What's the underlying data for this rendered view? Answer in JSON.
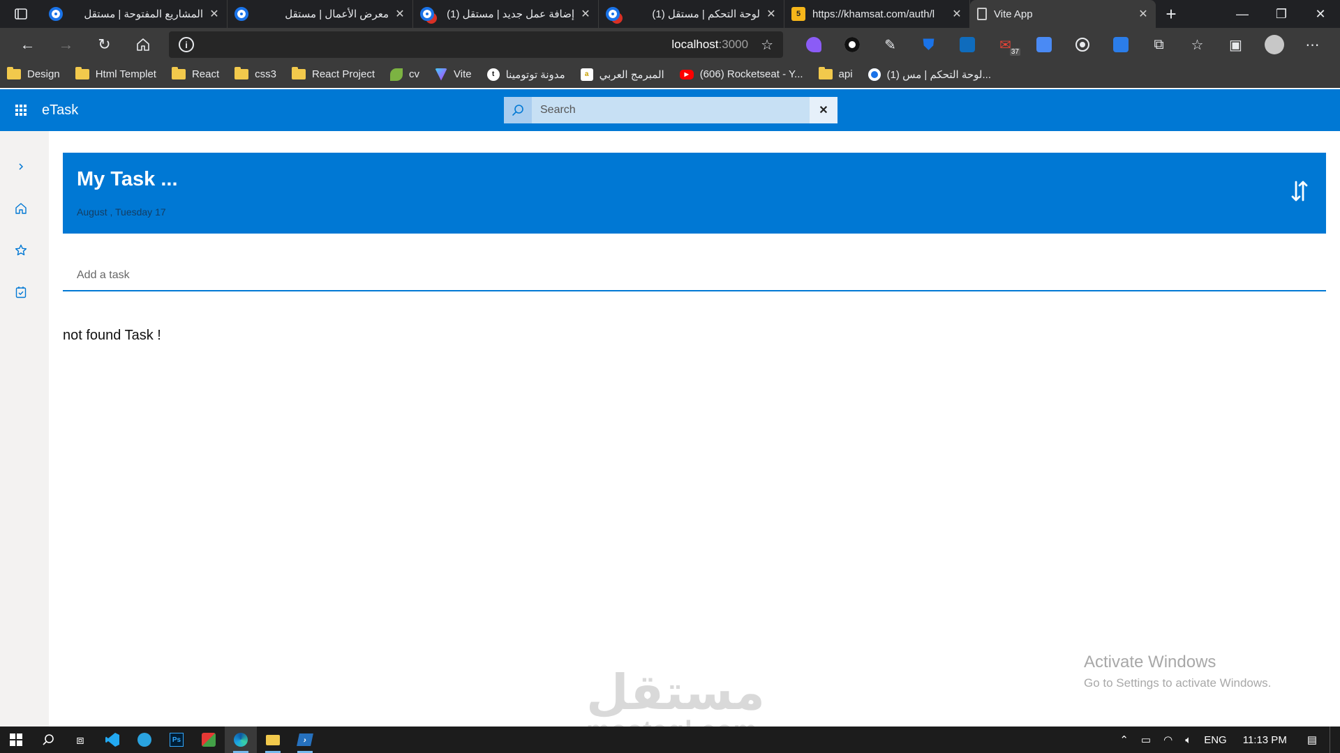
{
  "browser": {
    "tabs": [
      {
        "title": "المشاريع المفتوحة | مستقل",
        "fav": "mostaql",
        "active": false
      },
      {
        "title": "معرض الأعمال | مستقل",
        "fav": "mostaql",
        "active": false
      },
      {
        "title": "(1) إضافة عمل جديد | مستقل",
        "fav": "mostaql-badge",
        "active": false
      },
      {
        "title": "(1) لوحة التحكم | مستقل",
        "fav": "mostaql-badge",
        "active": false
      },
      {
        "title": "https://khamsat.com/auth/l",
        "fav": "khamsat",
        "active": false
      },
      {
        "title": "Vite App",
        "fav": "document",
        "active": true
      }
    ],
    "url_host": "localhost",
    "url_port": ":3000",
    "extension_badge_count": "37",
    "bookmarks": [
      {
        "label": "Design",
        "icon": "folder"
      },
      {
        "label": "Html Templet",
        "icon": "folder"
      },
      {
        "label": "React",
        "icon": "folder"
      },
      {
        "label": "css3",
        "icon": "folder"
      },
      {
        "label": "React Project",
        "icon": "folder"
      },
      {
        "label": "cv",
        "icon": "leaf"
      },
      {
        "label": "Vite",
        "icon": "vite"
      },
      {
        "label": "مدونة توتومينا",
        "icon": "tutomena"
      },
      {
        "label": "المبرمج العربي",
        "icon": "arab-programmer"
      },
      {
        "label": "(606) Rocketseat - Y...",
        "icon": "youtube"
      },
      {
        "label": "api",
        "icon": "folder"
      },
      {
        "label": "(1) لوحة التحكم | مس...",
        "icon": "mostaql"
      }
    ]
  },
  "app": {
    "brand": "eTask",
    "search_placeholder": "Search",
    "header_title": "My Task ...",
    "header_date": "August , Tuesday 17",
    "add_task_placeholder": "Add a task",
    "empty_message": "not found Task !",
    "accent": "#0078d4"
  },
  "overlays": {
    "activate_title": "Activate Windows",
    "activate_sub": "Go to Settings to activate Windows.",
    "logo_ar": "مستقل",
    "logo_en": "mostaql.com"
  },
  "taskbar": {
    "language": "ENG",
    "time": "11:13 PM"
  }
}
